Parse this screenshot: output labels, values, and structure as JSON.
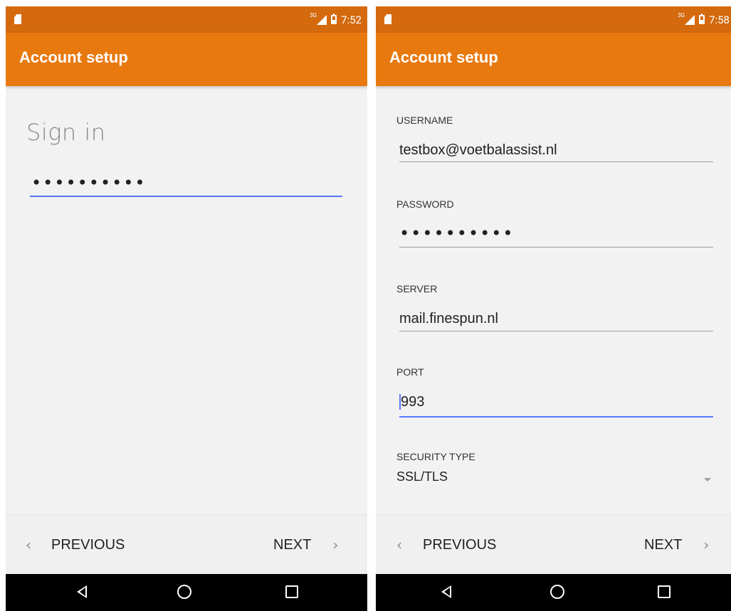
{
  "screens": [
    {
      "status_time": "7:52",
      "network_tag": "3G",
      "app_title": "Account setup",
      "heading": "Sign in",
      "password_masked": "••••••••••",
      "prev_label": "PREVIOUS",
      "next_label": "NEXT",
      "prev_chevron": "‹",
      "next_chevron": "›"
    },
    {
      "status_time": "7:58",
      "network_tag": "3G",
      "app_title": "Account setup",
      "fields": {
        "username": {
          "label": "USERNAME",
          "value": "testbox@voetbalassist.nl"
        },
        "password": {
          "label": "PASSWORD",
          "value": "••••••••••"
        },
        "server": {
          "label": "SERVER",
          "value": "mail.finespun.nl"
        },
        "port": {
          "label": "PORT",
          "value": "993"
        },
        "security_type": {
          "label": "SECURITY TYPE",
          "value": "SSL/TLS"
        }
      },
      "prev_label": "PREVIOUS",
      "next_label": "NEXT",
      "prev_chevron": "‹",
      "next_chevron": "›"
    }
  ],
  "colors": {
    "status_bar": "#d4690e",
    "app_bar": "#e8790f",
    "focus_line": "#5677fc",
    "background": "#f2f2f2"
  },
  "icons": {
    "status": [
      "sim-icon",
      "network-signal-icon",
      "battery-icon"
    ],
    "system_nav": [
      "back-icon",
      "home-icon",
      "recents-icon"
    ]
  }
}
